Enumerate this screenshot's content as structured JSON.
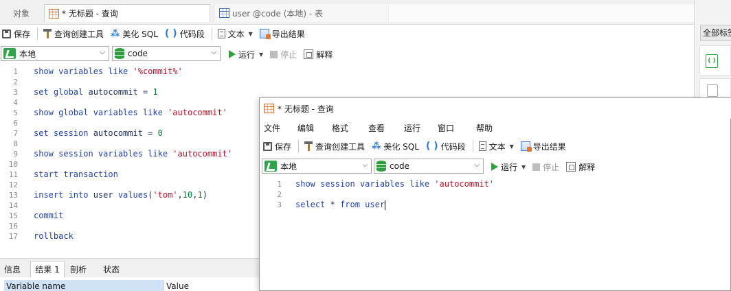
{
  "tabs": {
    "objects": "对象",
    "query": "* 无标题 - 查询",
    "table": "user @code (本地) - 表"
  },
  "toolbar": {
    "save": "保存",
    "query_builder": "查询创建工具",
    "beautify_sql": "美化 SQL",
    "code_snippet": "代码段",
    "text": "文本",
    "export_result": "导出结果"
  },
  "run_bar": {
    "connection": "本地",
    "database": "code",
    "run": "运行",
    "stop": "停止",
    "explain": "解释"
  },
  "editor": {
    "line_numbers": [
      "1",
      "2",
      "3",
      "4",
      "5",
      "6",
      "7",
      "8",
      "9",
      "10",
      "11",
      "12",
      "13",
      "14",
      "15",
      "16",
      "17"
    ],
    "lines": [
      [
        {
          "c": "kw",
          "t": "show variables like "
        },
        {
          "c": "str",
          "t": "'%commit%'"
        }
      ],
      [],
      [
        {
          "c": "kw",
          "t": "set global "
        },
        {
          "c": "plain",
          "t": "autocommit = "
        },
        {
          "c": "num",
          "t": "1"
        }
      ],
      [],
      [
        {
          "c": "kw",
          "t": "show global variables like "
        },
        {
          "c": "str",
          "t": "'autocommit'"
        }
      ],
      [],
      [
        {
          "c": "kw",
          "t": "set session "
        },
        {
          "c": "plain",
          "t": "autocommit = "
        },
        {
          "c": "num",
          "t": "0"
        }
      ],
      [],
      [
        {
          "c": "kw",
          "t": "show session variables like "
        },
        {
          "c": "str",
          "t": "'autocommit'"
        }
      ],
      [],
      [
        {
          "c": "kw",
          "t": "start transaction"
        }
      ],
      [],
      [
        {
          "c": "kw",
          "t": "insert into "
        },
        {
          "c": "plain",
          "t": "user "
        },
        {
          "c": "kw",
          "t": "values"
        },
        {
          "c": "plain",
          "t": "("
        },
        {
          "c": "str",
          "t": "'tom'"
        },
        {
          "c": "plain",
          "t": ","
        },
        {
          "c": "num",
          "t": "10"
        },
        {
          "c": "plain",
          "t": ","
        },
        {
          "c": "num",
          "t": "1"
        },
        {
          "c": "plain",
          "t": ")"
        }
      ],
      [],
      [
        {
          "c": "kw",
          "t": "commit"
        }
      ],
      [],
      [
        {
          "c": "kw",
          "t": "rollback"
        }
      ]
    ]
  },
  "bottom_tabs": {
    "info": "信息",
    "result1": "结果 1",
    "profile": "剖析",
    "status": "状态"
  },
  "result_grid": {
    "col1": "Variable name",
    "col2": "Value"
  },
  "right_panel": {
    "all_tags": "全部标签"
  },
  "float_window": {
    "title": "* 无标题 - 查询",
    "menu": [
      "文件",
      "编辑",
      "格式",
      "查看",
      "运行",
      "窗口",
      "帮助"
    ],
    "editor": {
      "line_numbers": [
        "1",
        "2",
        "3"
      ],
      "lines": [
        [
          {
            "c": "kw",
            "t": "show session variables like "
          },
          {
            "c": "str",
            "t": "'autocommit'"
          }
        ],
        [],
        [
          {
            "c": "kw",
            "t": "select "
          },
          {
            "c": "plain",
            "t": "* "
          },
          {
            "c": "kw",
            "t": "from "
          },
          {
            "c": "kw",
            "t": "user"
          }
        ]
      ]
    }
  },
  "colors": {
    "keyword": "#2343a8",
    "string": "#b3132a",
    "number": "#0a7a38",
    "run_green": "#2da63a"
  }
}
